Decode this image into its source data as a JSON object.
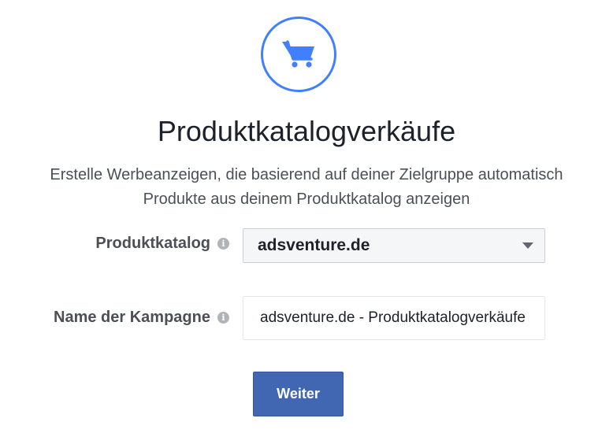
{
  "header": {
    "icon": "shopping-cart-icon",
    "title": "Produktkatalogverkäufe",
    "description_line1": "Erstelle Werbeanzeigen, die basierend auf deiner Zielgruppe automatisch",
    "description_line2": "Produkte aus deinem Produktkatalog anzeigen"
  },
  "form": {
    "catalog_label": "Produktkatalog",
    "catalog_value": "adsventure.de",
    "campaign_label": "Name der Kampagne",
    "campaign_value": "adsventure.de - Produktkatalogverkäufe",
    "info_glyph": "i"
  },
  "actions": {
    "next_label": "Weiter"
  },
  "colors": {
    "accent": "#4080ff",
    "button": "#4267b2"
  }
}
